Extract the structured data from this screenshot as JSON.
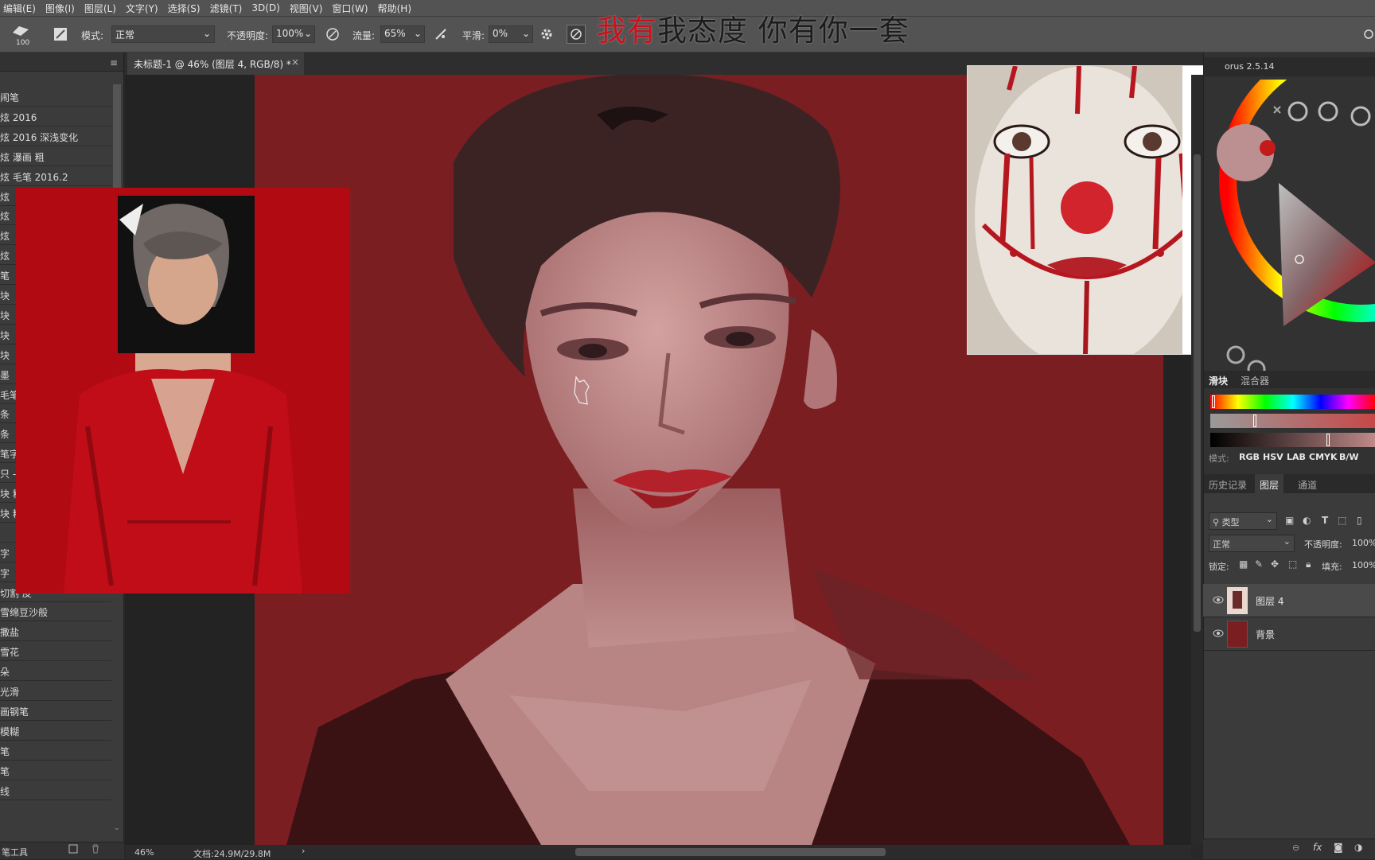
{
  "menu": [
    "编辑(E)",
    "图像(I)",
    "图层(L)",
    "文字(Y)",
    "选择(S)",
    "滤镜(T)",
    "3D(D)",
    "视图(V)",
    "窗口(W)",
    "帮助(H)"
  ],
  "caption": {
    "part1": "我有",
    "part2": "我态度 你有你一套"
  },
  "options": {
    "brush_size": "100",
    "mode_label": "模式:",
    "mode_value": "正常",
    "opacity_label": "不透明度:",
    "opacity_value": "100%",
    "flow_label": "流量:",
    "flow_value": "65%",
    "smooth_label": "平滑:",
    "smooth_value": "0%"
  },
  "document_tab": "未标题-1 @ 46% (图层 4, RGB/8) *",
  "brushes": [
    "闹笔",
    "炫 2016",
    "炫 2016 深浅变化",
    "炫 瀑画 粗",
    "炫 毛笔 2016.2",
    "炫",
    "炫",
    "炫",
    "炫",
    "笔",
    "块",
    "块",
    "块",
    "块",
    "墨",
    "毛笔",
    "条",
    "条",
    "笔字",
    "只 - 5",
    "块 粗",
    "块 粉",
    "",
    "字",
    "字",
    "切割 皮",
    "雪绵豆沙般",
    "撒盐",
    "雪花",
    "朵",
    "光滑",
    "画钢笔",
    "模糊",
    "笔",
    "笔",
    "线"
  ],
  "left_footer_label": "笔工具",
  "status": {
    "zoom": "46%",
    "doc": "文档:24.9M/29.8M"
  },
  "right": {
    "plugin_tab": "orus 2.5.14",
    "slider_tab": "滑块",
    "mixer_tab": "混合器",
    "mode_label": "模式:",
    "color_modes": [
      "RGB",
      "HSV",
      "LAB",
      "CMYK",
      "B/W"
    ],
    "history_tab": "历史记录",
    "layers_tab": "图层",
    "channels_tab": "通道",
    "filter_kind": "类型",
    "blend_mode": "正常",
    "opacity_label": "不透明度:",
    "opacity_value": "100%",
    "lock_label": "锁定:",
    "fill_label": "填充:",
    "fill_value": "100%",
    "layers": [
      {
        "name": "图层 4"
      },
      {
        "name": "背景"
      }
    ]
  },
  "colors": {
    "canvas_bg": "#7b1e22",
    "panel_bg": "#323232",
    "toolbar_bg": "#535353",
    "caption_red": "#c9121c"
  }
}
